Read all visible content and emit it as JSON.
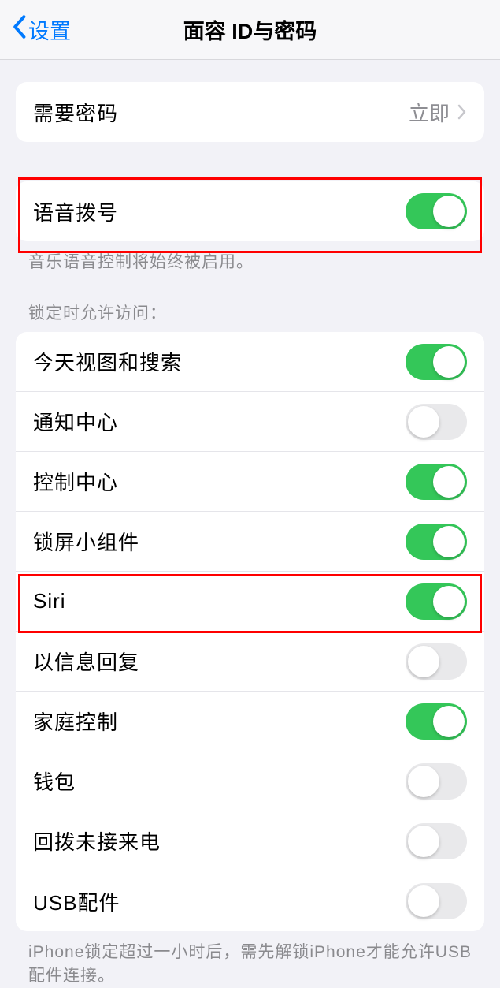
{
  "header": {
    "back_label": "设置",
    "title": "面容 ID与密码"
  },
  "passcode_row": {
    "label": "需要密码",
    "value": "立即"
  },
  "voice_dial": {
    "label": "语音拨号",
    "on": true,
    "footer": "音乐语音控制将始终被启用。"
  },
  "lock_access": {
    "header": "锁定时允许访问：",
    "items": [
      {
        "label": "今天视图和搜索",
        "on": true
      },
      {
        "label": "通知中心",
        "on": false
      },
      {
        "label": "控制中心",
        "on": true
      },
      {
        "label": "锁屏小组件",
        "on": true
      },
      {
        "label": "Siri",
        "on": true
      },
      {
        "label": "以信息回复",
        "on": false
      },
      {
        "label": "家庭控制",
        "on": true
      },
      {
        "label": "钱包",
        "on": false
      },
      {
        "label": "回拨未接来电",
        "on": false
      },
      {
        "label": "USB配件",
        "on": false
      }
    ],
    "footer": "iPhone锁定超过一小时后，需先解锁iPhone才能允许USB配件连接。"
  }
}
